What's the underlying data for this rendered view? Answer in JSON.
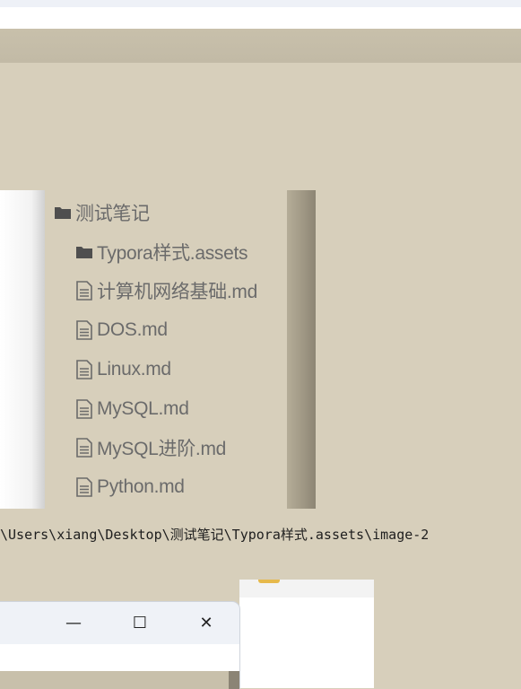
{
  "tree": {
    "items": [
      {
        "label": "测试笔记",
        "icon": "folder-icon",
        "indent": 0
      },
      {
        "label": "Typora样式.assets",
        "icon": "folder-icon",
        "indent": 1
      },
      {
        "label": "计算机网络基础.md",
        "icon": "file-icon",
        "indent": 1
      },
      {
        "label": "DOS.md",
        "icon": "file-icon",
        "indent": 1
      },
      {
        "label": "Linux.md",
        "icon": "file-icon",
        "indent": 1
      },
      {
        "label": "MySQL.md",
        "icon": "file-icon",
        "indent": 1
      },
      {
        "label": "MySQL进阶.md",
        "icon": "file-icon",
        "indent": 1
      },
      {
        "label": "Python.md",
        "icon": "file-icon",
        "indent": 1
      }
    ]
  },
  "path_text": "\\Users\\xiang\\Desktop\\测试笔记\\Typora样式.assets\\image-2",
  "window": {
    "minimize_label": "—",
    "maximize_label": "☐",
    "close_label": "✕"
  },
  "colors": {
    "background": "#d7cfbb",
    "tree_text": "#6b6b6b",
    "accent_tab": "#e6b94b"
  }
}
